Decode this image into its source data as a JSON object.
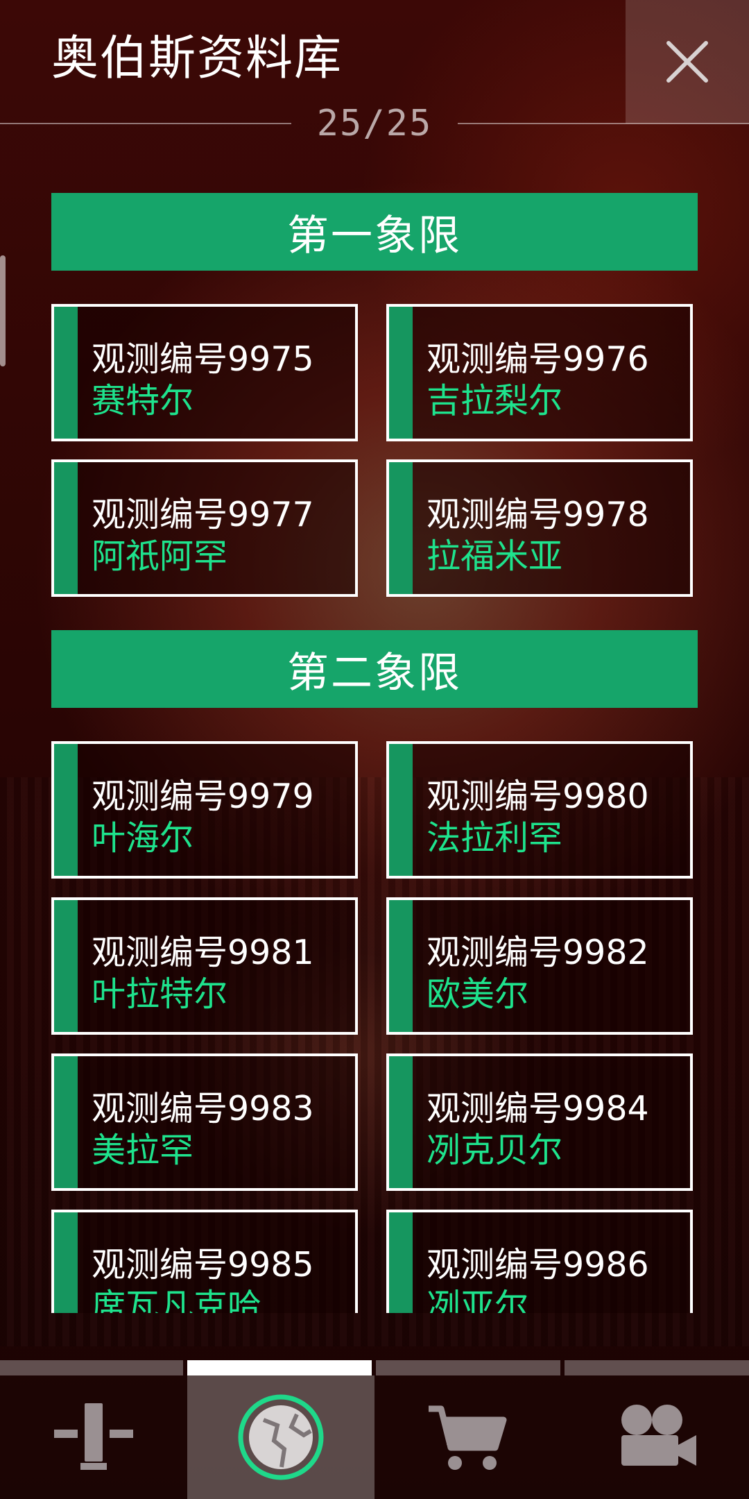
{
  "header": {
    "title": "奥伯斯资料库",
    "counter": "25/25"
  },
  "sections": [
    {
      "title": "第一象限",
      "cards": [
        {
          "number": "观测编号9975",
          "name": "赛特尔"
        },
        {
          "number": "观测编号9976",
          "name": "吉拉梨尔"
        },
        {
          "number": "观测编号9977",
          "name": "阿祇阿罕"
        },
        {
          "number": "观测编号9978",
          "name": "拉福米亚"
        }
      ]
    },
    {
      "title": "第二象限",
      "cards": [
        {
          "number": "观测编号9979",
          "name": "叶海尔"
        },
        {
          "number": "观测编号9980",
          "name": "法拉利罕"
        },
        {
          "number": "观测编号9981",
          "name": "叶拉特尔"
        },
        {
          "number": "观测编号9982",
          "name": "欧美尔"
        },
        {
          "number": "观测编号9983",
          "name": "美拉罕"
        },
        {
          "number": "观测编号9984",
          "name": "冽克贝尔"
        },
        {
          "number": "观测编号9985",
          "name": "席瓦凡克哈"
        },
        {
          "number": "观测编号9986",
          "name": "冽亚尔"
        }
      ]
    }
  ],
  "nav": {
    "items": [
      {
        "icon": "tower-icon"
      },
      {
        "icon": "planet-icon"
      },
      {
        "icon": "cart-icon"
      },
      {
        "icon": "video-camera-icon"
      }
    ],
    "active_index": 1
  },
  "colors": {
    "accent": "#16a56a",
    "name_text": "#1ee38d",
    "background": "#2a0504"
  }
}
